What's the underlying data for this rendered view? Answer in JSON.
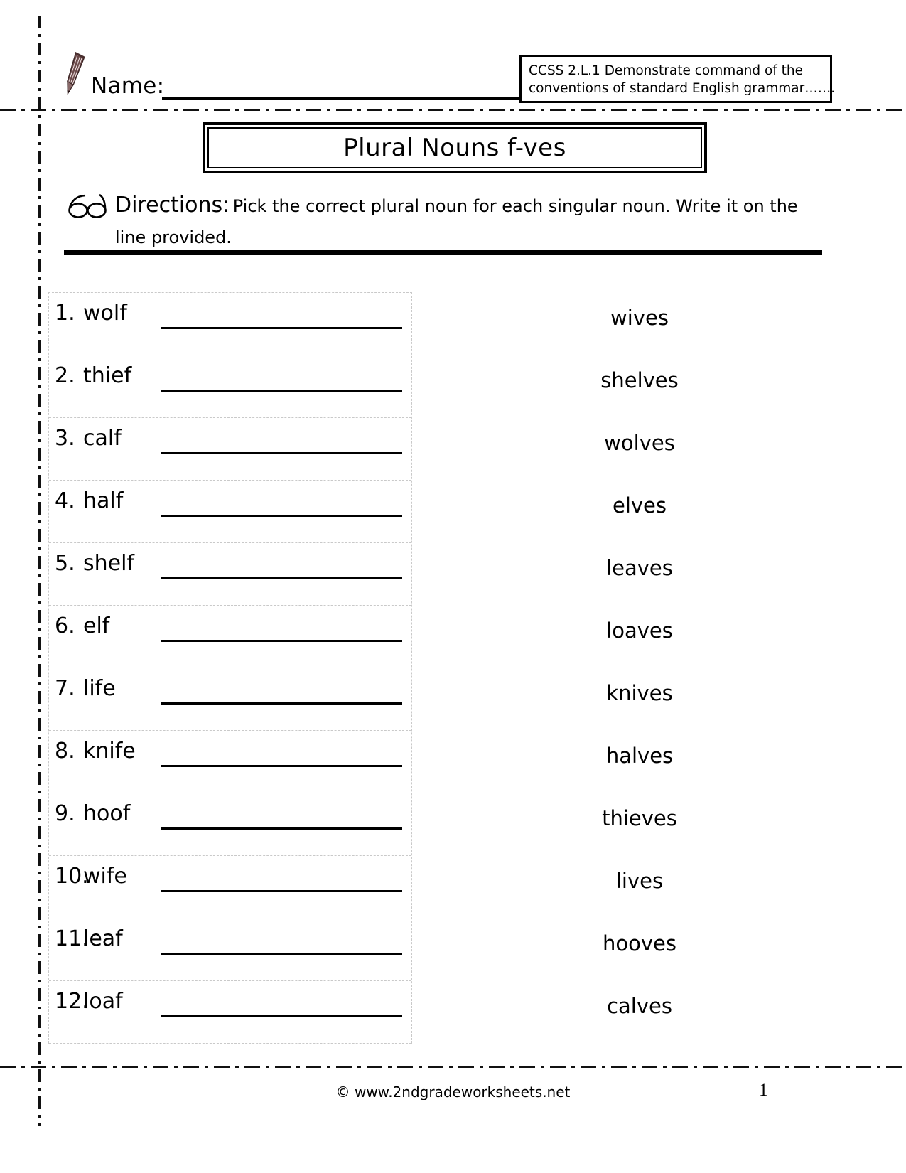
{
  "header": {
    "name_label": "Name:",
    "name_value": "",
    "pencil_icon": "pencil-icon",
    "ccss": {
      "line1": "CCSS 2.L.1 Demonstrate command of the",
      "line2": "conventions of standard English grammar……."
    }
  },
  "title": "Plural Nouns f-ves",
  "directions": {
    "icon": "glasses-icon",
    "label": "Directions:",
    "line1": "Pick the correct plural noun for each singular noun.  Write it on the",
    "line2": "line provided."
  },
  "exercises": [
    {
      "number": "1.",
      "word": "wolf",
      "answer": ""
    },
    {
      "number": "2.",
      "word": "thief",
      "answer": ""
    },
    {
      "number": "3.",
      "word": "calf",
      "answer": ""
    },
    {
      "number": "4.",
      "word": "half",
      "answer": ""
    },
    {
      "number": "5.",
      "word": "shelf",
      "answer": ""
    },
    {
      "number": "6.",
      "word": "elf",
      "answer": ""
    },
    {
      "number": "7.",
      "word": "life",
      "answer": ""
    },
    {
      "number": "8.",
      "word": "knife",
      "answer": ""
    },
    {
      "number": "9.",
      "word": "hoof",
      "answer": ""
    },
    {
      "number": "10.",
      "word": "wife",
      "answer": ""
    },
    {
      "number": "11.",
      "word": "leaf",
      "answer": ""
    },
    {
      "number": "12.",
      "word": "loaf",
      "answer": ""
    }
  ],
  "word_bank": [
    "wives",
    "shelves",
    "wolves",
    "elves",
    "leaves",
    "loaves",
    "knives",
    "halves",
    "thieves",
    "lives",
    "hooves",
    "calves"
  ],
  "footer": {
    "credit": "© www.2ndgradeworksheets.net",
    "page_number": "1"
  },
  "colors": {
    "ink": "#000000",
    "paper": "#ffffff",
    "pencil_body": "#6b4a4a",
    "pencil_dark": "#4a2f2f",
    "dotted_rule": "#c9c9c9"
  }
}
